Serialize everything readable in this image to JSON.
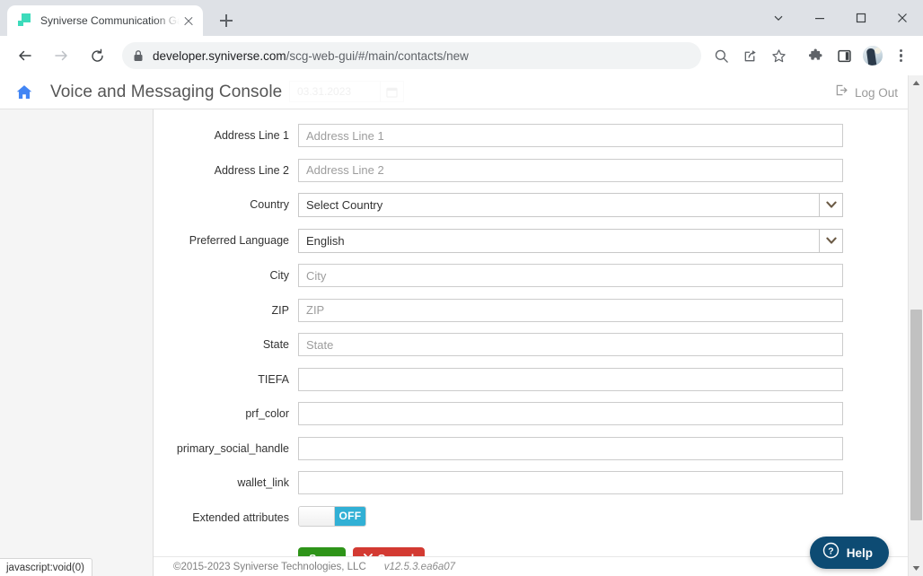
{
  "browser": {
    "tab": {
      "title": "Syniverse Communication Gatew",
      "favicon": "syniverse-logo-icon",
      "close": "close-tab-icon"
    },
    "new_tab_label": "+",
    "window_controls": {
      "tab_search": "chevron-down-icon",
      "minimize": "minimize-icon",
      "maximize": "maximize-icon",
      "close": "close-window-icon"
    },
    "nav": {
      "back": "back-arrow-icon",
      "forward": "forward-arrow-icon",
      "reload": "reload-icon"
    },
    "omnibox": {
      "lock": "lock-icon",
      "url_host": "developer.syniverse.com",
      "url_path": "/scg-web-gui/#/main/contacts/new",
      "full_url": "developer.syniverse.com/scg-web-gui/#/main/contacts/new"
    },
    "toolbar_icons": [
      {
        "name": "search-icon"
      },
      {
        "name": "share-icon"
      },
      {
        "name": "bookmark-star-icon"
      },
      {
        "name": "extensions-puzzle-icon"
      },
      {
        "name": "side-panel-icon"
      },
      {
        "name": "profile-avatar-icon"
      },
      {
        "name": "chrome-menu-icon"
      }
    ]
  },
  "app": {
    "home_icon": "home-icon",
    "title": "Voice and Messaging Console",
    "date_field": {
      "value": "03.31.2023",
      "calendar_icon": "calendar-icon"
    },
    "logout": {
      "icon": "logout-icon",
      "label": "Log Out"
    }
  },
  "form": {
    "fields": [
      {
        "label": "Address Line 1",
        "type": "text",
        "placeholder": "Address Line 1",
        "value": "",
        "name": "address-line-1"
      },
      {
        "label": "Address Line 2",
        "type": "text",
        "placeholder": "Address Line 2",
        "value": "",
        "name": "address-line-2"
      },
      {
        "label": "Country",
        "type": "select",
        "value": "Select Country",
        "name": "country"
      },
      {
        "label": "Preferred Language",
        "type": "select",
        "value": "English",
        "name": "preferred-language"
      },
      {
        "label": "City",
        "type": "text",
        "placeholder": "City",
        "value": "",
        "name": "city"
      },
      {
        "label": "ZIP",
        "type": "text",
        "placeholder": "ZIP",
        "value": "",
        "name": "zip"
      },
      {
        "label": "State",
        "type": "text",
        "placeholder": "State",
        "value": "",
        "name": "state"
      },
      {
        "label": "TIEFA",
        "type": "text",
        "placeholder": "",
        "value": "",
        "name": "tiefa"
      },
      {
        "label": "prf_color",
        "type": "text",
        "placeholder": "",
        "value": "",
        "name": "prf-color"
      },
      {
        "label": "primary_social_handle",
        "type": "text",
        "placeholder": "",
        "value": "",
        "name": "primary-social-handle"
      },
      {
        "label": "wallet_link",
        "type": "text",
        "placeholder": "",
        "value": "",
        "name": "wallet-link"
      }
    ],
    "extended_attributes": {
      "label": "Extended attributes",
      "state": "OFF"
    },
    "buttons": {
      "save": "Save",
      "cancel": "Cancel",
      "cancel_icon": "x-mark-icon"
    }
  },
  "footer": {
    "copyright": "©2015-2023 Syniverse Technologies, LLC",
    "version": "v12.5.3.ea6a07"
  },
  "help_widget": {
    "icon": "question-mark-icon",
    "label": "Help"
  },
  "status_bar": {
    "text": "javascript:void(0)"
  },
  "scrollbar": {
    "up": "scroll-up-arrow-icon",
    "down": "scroll-down-arrow-icon",
    "thumb": "scroll-thumb"
  },
  "colors": {
    "accent_blue": "#4285f4",
    "toggle_on": "#31b0d5",
    "save_green": "#2e9419",
    "cancel_red": "#d33a32",
    "help_navy": "#0d4b73",
    "favicon_teal": "#3ddbbb"
  }
}
